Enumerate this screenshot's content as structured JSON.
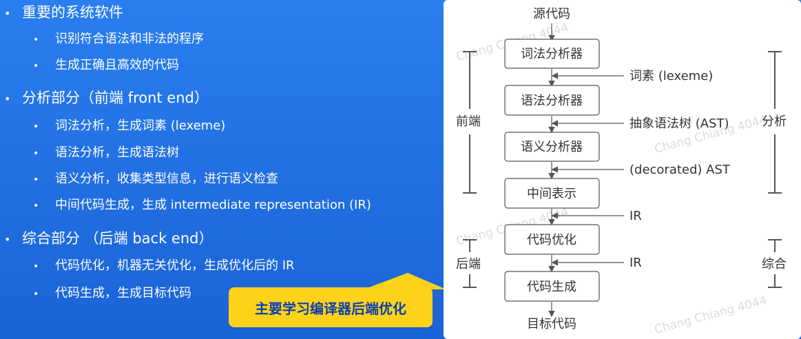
{
  "outline": {
    "sections": [
      {
        "title": "重要的系统软件",
        "items": [
          "识别符合语法和非法的程序",
          "生成正确且高效的代码"
        ]
      },
      {
        "title": "分析部分（前端 front end）",
        "items": [
          "词法分析，生成词素 (lexeme)",
          "语法分析，生成语法树",
          "语义分析，收集类型信息，进行语义检查",
          "中间代码生成，生成 intermediate representation (IR)"
        ]
      },
      {
        "title": "综合部分 （后端 back end）",
        "items": [
          "代码优化，机器无关优化，生成优化后的 IR",
          "代码生成，生成目标代码"
        ]
      }
    ],
    "bullet": "•"
  },
  "callout": {
    "text": "主要学习编译器后端优化"
  },
  "diagram": {
    "source": "源代码",
    "stages": [
      "词法分析器",
      "语法分析器",
      "语义分析器",
      "中间表示",
      "代码优化",
      "代码生成"
    ],
    "edge_labels": [
      "词素 (lexeme)",
      "抽象语法树 (AST)",
      "(decorated) AST",
      "IR",
      "IR"
    ],
    "target": "目标代码",
    "groups": {
      "front_left": "前端",
      "back_left": "后端",
      "analysis_right": "分析",
      "synthesis_right": "综合"
    },
    "watermark": "Chang Chiang 4044"
  },
  "colors": {
    "background": "#1f6fe0",
    "callout": "#ffd21a",
    "callout_text": "#0b3fb0",
    "diagram_bg": "#ffffff",
    "stroke": "#555555"
  }
}
